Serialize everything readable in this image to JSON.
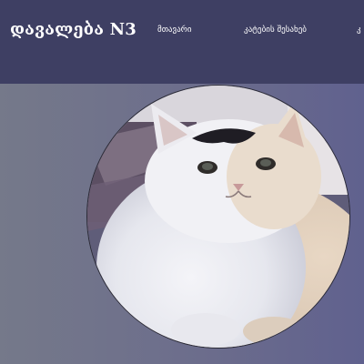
{
  "header": {
    "title": "დავალება N3",
    "nav": [
      {
        "label": "მთავარი"
      },
      {
        "label": "კატების შესახებ"
      },
      {
        "label": "კ"
      }
    ]
  },
  "main": {
    "photo_icon": "cat-photo"
  },
  "colors": {
    "header_bg": "#3e3f63",
    "page_bg_left": "#75798a",
    "page_bg_right": "#60618e"
  }
}
